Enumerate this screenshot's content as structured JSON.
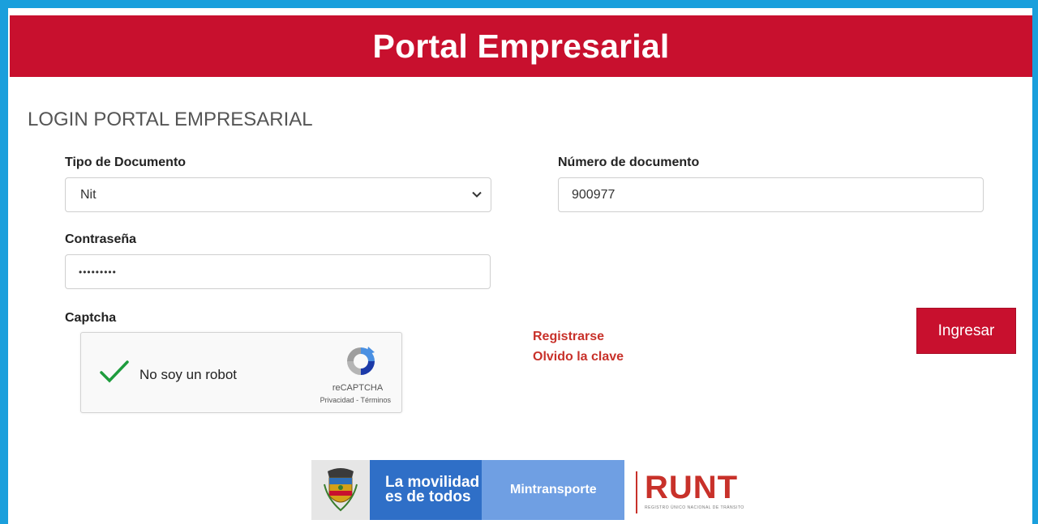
{
  "header": {
    "title": "Portal Empresarial"
  },
  "login": {
    "section_title": "LOGIN PORTAL EMPRESARIAL",
    "doc_type": {
      "label": "Tipo de Documento",
      "selected": "Nit"
    },
    "doc_number": {
      "label": "Número de documento",
      "value": "900977"
    },
    "password": {
      "label": "Contraseña",
      "value": "•••••••••"
    },
    "captcha": {
      "label": "Captcha",
      "checkbox_label": "No soy un robot",
      "brand": "reCAPTCHA",
      "terms": "Privacidad - Términos"
    },
    "links": {
      "register": "Registrarse",
      "forgot": "Olvido la clave"
    },
    "submit_label": "Ingresar"
  },
  "footer": {
    "slogan_line1": "La movilidad",
    "slogan_line2": "es de todos",
    "ministry": "Mintransporte",
    "runt": "RUNT",
    "runt_subtitle": "REGISTRO ÚNICO NACIONAL DE TRÁNSITO"
  },
  "colors": {
    "brand_red": "#c8102e",
    "link_red": "#c8312a",
    "frame_blue": "#1a9fdc",
    "mov_blue": "#2f6fc7",
    "mintra_blue": "#6f9fe3"
  }
}
